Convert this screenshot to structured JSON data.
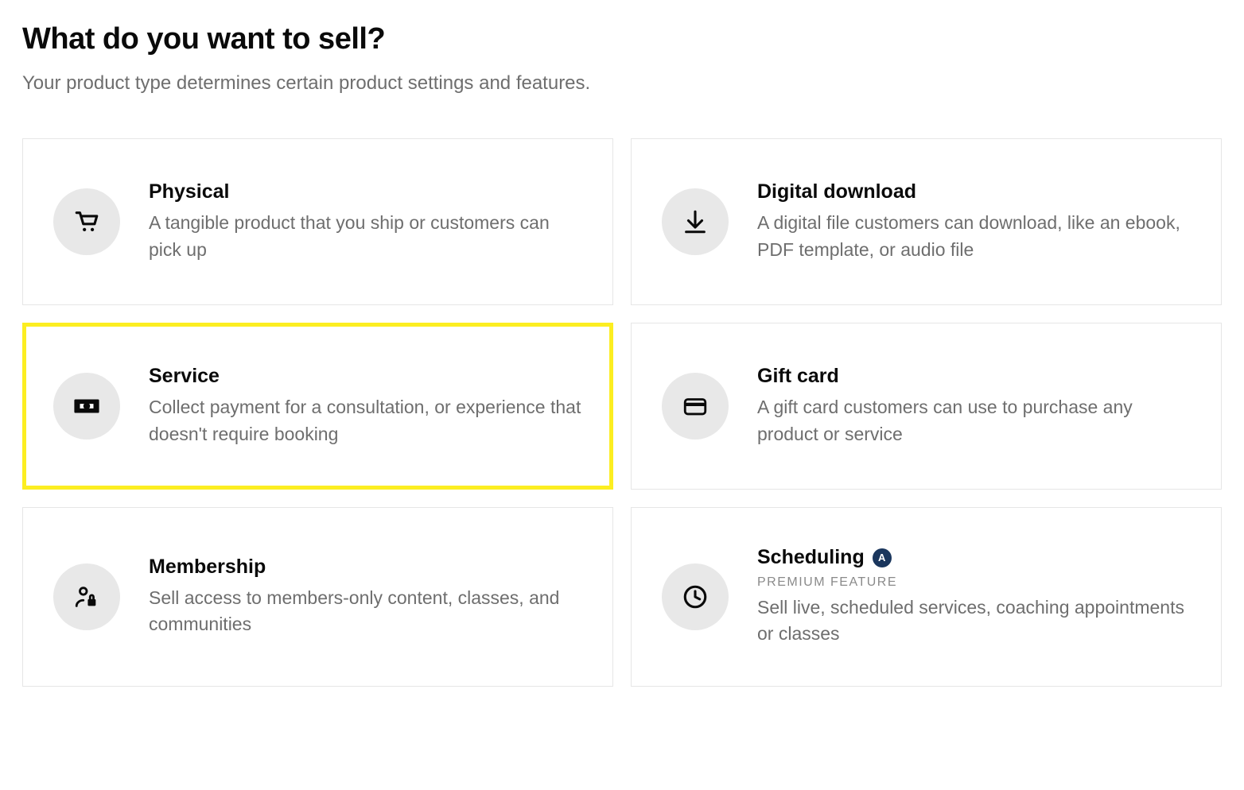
{
  "header": {
    "title": "What do you want to sell?",
    "subtitle": "Your product type determines certain product settings and features."
  },
  "options": {
    "physical": {
      "title": "Physical",
      "desc": "A tangible product that you ship or customers can pick up",
      "icon": "cart-icon"
    },
    "digital": {
      "title": "Digital download",
      "desc": "A digital file customers can download, like an ebook, PDF template, or audio file",
      "icon": "download-icon"
    },
    "service": {
      "title": "Service",
      "desc": "Collect payment for a consultation, or experience that doesn't require booking",
      "icon": "money-icon",
      "highlighted": true
    },
    "giftcard": {
      "title": "Gift card",
      "desc": "A gift card customers can use to purchase any product or service",
      "icon": "card-icon"
    },
    "membership": {
      "title": "Membership",
      "desc": "Sell access to members-only content, classes, and communities",
      "icon": "person-lock-icon"
    },
    "scheduling": {
      "title": "Scheduling",
      "premium_label": "PREMIUM FEATURE",
      "desc": "Sell live, scheduled services, coaching appointments or classes",
      "icon": "clock-icon",
      "badge": "A"
    }
  }
}
